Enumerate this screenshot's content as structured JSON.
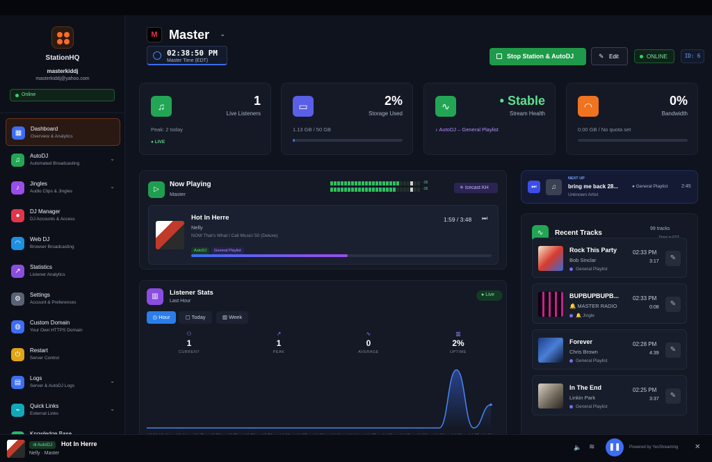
{
  "sidebar": {
    "brand": "StationHQ",
    "user": "masterkiddj",
    "email": "masterkiddj@yahoo.com",
    "status": "Online",
    "items": [
      {
        "title": "Dashboard",
        "sub": "Overview & Analytics",
        "icon": "grid-icon",
        "color": "#3d6df2"
      },
      {
        "title": "AutoDJ",
        "sub": "Automated Broadcasting",
        "icon": "headphones-icon",
        "color": "#22a655"
      },
      {
        "title": "Jingles",
        "sub": "Audio Clips & Jingles",
        "icon": "music-icon",
        "color": "#9a4de8"
      },
      {
        "title": "DJ Manager",
        "sub": "DJ Accounts & Access",
        "icon": "mic-icon",
        "color": "#e2354a"
      },
      {
        "title": "Web DJ",
        "sub": "Browser Broadcasting",
        "icon": "wifi-icon",
        "color": "#1f8fe0"
      },
      {
        "title": "Statistics",
        "sub": "Listener Analytics",
        "icon": "chart-icon",
        "color": "#8b4de0"
      },
      {
        "title": "Settings",
        "sub": "Account & Preferences",
        "icon": "gear-icon",
        "color": "#5a6275"
      },
      {
        "title": "Custom Domain",
        "sub": "Your Own HTTPS Domain",
        "icon": "globe-icon",
        "color": "#3d6df2"
      },
      {
        "title": "Restart",
        "sub": "Server Control",
        "icon": "power-icon",
        "color": "#e0a514"
      },
      {
        "title": "Logs",
        "sub": "Server & AutoDJ Logs",
        "icon": "file-icon",
        "color": "#3d6df2"
      },
      {
        "title": "Quick Links",
        "sub": "External Links",
        "icon": "link-icon",
        "color": "#12a8b8"
      },
      {
        "title": "Knowledge Base",
        "sub": "",
        "icon": "book-icon",
        "color": "#2bb56a"
      }
    ]
  },
  "header": {
    "title": "Master",
    "clock": "02:38:50 PM",
    "clock_label": "Master Time (EDT)",
    "stop_label": "Stop Station & AutoDJ",
    "edit_label": "Edit",
    "status": "ONLINE",
    "id": "ID: 6"
  },
  "stats": {
    "listeners": {
      "value": "1",
      "label": "Live Listeners",
      "peak": "Peak: 2 today",
      "live": "LIVE"
    },
    "storage": {
      "value": "2%",
      "label": "Storage Used",
      "detail": "1.13 GB / 50 GB",
      "fill": 0.02
    },
    "health": {
      "value": "Stable",
      "label": "Stream Health",
      "detail": "AutoDJ – General Playlist"
    },
    "bandwidth": {
      "value": "0%",
      "label": "Bandwidth",
      "detail": "0.00 GB / No quota set",
      "fill": 0
    }
  },
  "now_playing": {
    "heading": "Now Playing",
    "station": "Master",
    "source": "Icecast KH",
    "meter_l": "-15",
    "meter_r": "-15",
    "title": "Hot In Herre",
    "artist": "Nelly",
    "album": "NOW That's What I Call Music! 50 (Deluxe)",
    "time": "1:59 / 3:48",
    "tag1": "AutoDJ",
    "tag2": "General Playlist",
    "progress": 0.52
  },
  "next_up": {
    "label": "NEXT UP",
    "title": "bring me back 28...",
    "artist": "Unknown Artist",
    "playlist": "General Playlist",
    "duration": "2:45"
  },
  "listener_stats": {
    "heading": "Listener Stats",
    "sub": "Last Hour",
    "live": "Live",
    "tabs": [
      "Hour",
      "Today",
      "Week"
    ],
    "metrics": [
      {
        "v": "1",
        "l": "CURRENT"
      },
      {
        "v": "1",
        "l": "PEAK"
      },
      {
        "v": "0",
        "l": "AVERAGE"
      },
      {
        "v": "2%",
        "l": "UPTIME"
      }
    ]
  },
  "chart_data": {
    "type": "area",
    "x": [
      "13:38",
      "13:41",
      "13:44",
      "13:47",
      "13:50",
      "13:53",
      "13:56",
      "13:59",
      "14:02",
      "14:05",
      "14:08",
      "14:11",
      "14:14",
      "14:17",
      "14:20",
      "14:23",
      "14:26",
      "14:29",
      "14:32",
      "14:35",
      "14:38"
    ],
    "series": [
      {
        "values": [
          0,
          0,
          0,
          0,
          0,
          0,
          0,
          0,
          0,
          0,
          0,
          0,
          0,
          0,
          0,
          0,
          0,
          0,
          1,
          0,
          0.4
        ]
      }
    ],
    "ylim": [
      0,
      1.1
    ]
  },
  "recent": {
    "heading": "Recent Tracks",
    "count": "99 tracks",
    "tz": "Times in EDT",
    "tracks": [
      {
        "title": "Rock This Party",
        "artist": "Bob Sinclar",
        "playlist": "General Playlist",
        "time": "02:33 PM",
        "dur": "3:17"
      },
      {
        "title": "BUPBUPBUPB...",
        "artist": "🔔 MASTER RADIO",
        "playlist": "🔔 Jingle",
        "time": "02:33 PM",
        "dur": "0:08"
      },
      {
        "title": "Forever",
        "artist": "Chris Brown",
        "playlist": "General Playlist",
        "time": "02:28 PM",
        "dur": "4:39"
      },
      {
        "title": "In The End",
        "artist": "Linkin Park",
        "playlist": "General Playlist",
        "time": "02:25 PM",
        "dur": "3:37"
      }
    ]
  },
  "player": {
    "tag": "AutoDJ",
    "title": "Hot In Herre",
    "sub": "Nelly · Master",
    "powered": "Powered by YesStreaming"
  }
}
